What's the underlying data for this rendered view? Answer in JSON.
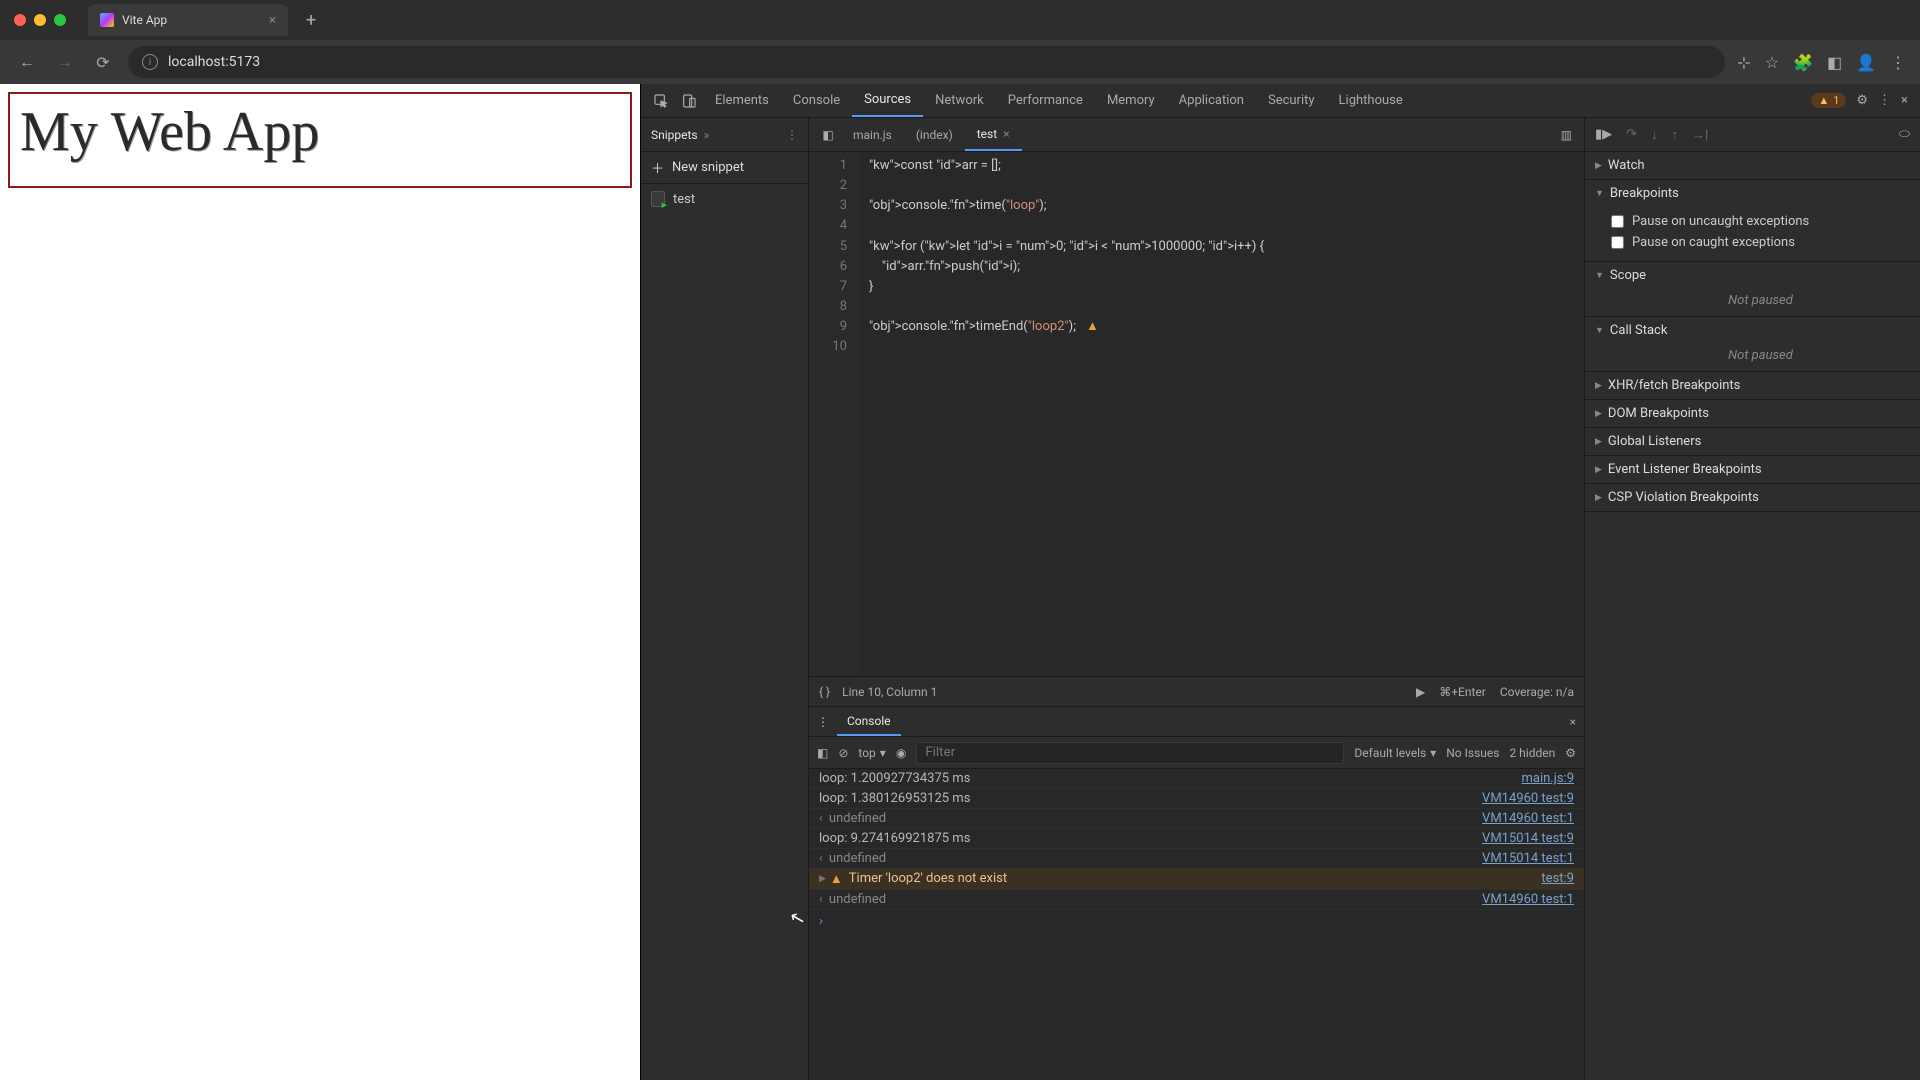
{
  "browser": {
    "tab_title": "Vite App",
    "url": "localhost:5173"
  },
  "page": {
    "heading": "My Web App"
  },
  "devtools": {
    "tabs": [
      "Elements",
      "Console",
      "Sources",
      "Network",
      "Performance",
      "Memory",
      "Application",
      "Security",
      "Lighthouse"
    ],
    "active_tab": "Sources",
    "error_count": "1",
    "snippets": {
      "header": "Snippets",
      "new_label": "New snippet",
      "items": [
        "test"
      ]
    },
    "open_files": [
      "main.js",
      "(index)",
      "test"
    ],
    "active_file": "test",
    "code_lines": [
      "const arr = [];",
      "",
      "console.time(\"loop\");",
      "",
      "for (let i = 0; i < 1000000; i++) {",
      "    arr.push(i);",
      "}",
      "",
      "console.timeEnd(\"loop2\");",
      ""
    ],
    "editor_status": "Line 10, Column 1",
    "run_hint": "⌘+Enter",
    "coverage": "Coverage: n/a",
    "debugger": {
      "sections": [
        "Watch",
        "Breakpoints",
        "Scope",
        "Call Stack",
        "XHR/fetch Breakpoints",
        "DOM Breakpoints",
        "Global Listeners",
        "Event Listener Breakpoints",
        "CSP Violation Breakpoints"
      ],
      "breakpoints": {
        "uncaught": "Pause on uncaught exceptions",
        "caught": "Pause on caught exceptions"
      },
      "not_paused": "Not paused"
    },
    "console": {
      "drawer_label": "Console",
      "context": "top",
      "filter_placeholder": "Filter",
      "levels": "Default levels",
      "issues": "No Issues",
      "hidden": "2 hidden",
      "rows": [
        {
          "type": "log",
          "msg": "loop: 1.200927734375 ms",
          "src": "main.js:9"
        },
        {
          "type": "log",
          "msg": "loop: 1.380126953125 ms",
          "src": "VM14960 test:9"
        },
        {
          "type": "und",
          "msg": "undefined",
          "src": "VM14960 test:1"
        },
        {
          "type": "log",
          "msg": "loop: 9.274169921875 ms",
          "src": "VM15014 test:9"
        },
        {
          "type": "und",
          "msg": "undefined",
          "src": "VM15014 test:1"
        },
        {
          "type": "warn",
          "msg": "Timer 'loop2' does not exist",
          "src": "test:9"
        },
        {
          "type": "und",
          "msg": "undefined",
          "src": "VM14960 test:1"
        }
      ]
    }
  }
}
